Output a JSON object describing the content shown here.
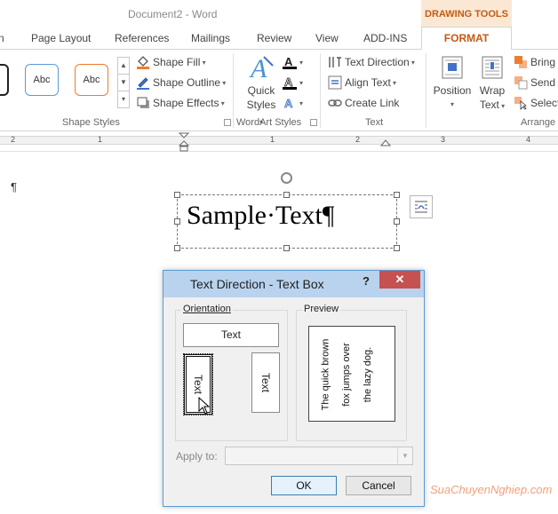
{
  "window": {
    "title": "Document2 - Word"
  },
  "contextual_tab_group": "DRAWING TOOLS",
  "tabs": [
    "n",
    "Page Layout",
    "References",
    "Mailings",
    "Review",
    "View",
    "ADD-INS"
  ],
  "active_tab": "FORMAT",
  "ribbon": {
    "shape_styles": {
      "gallery": [
        "Abc",
        "Abc"
      ],
      "shape_fill": "Shape Fill",
      "shape_outline": "Shape Outline",
      "shape_effects": "Shape Effects",
      "label": "Shape Styles"
    },
    "wordart_styles": {
      "quick_styles_line1": "Quick",
      "quick_styles_line2": "Styles",
      "label": "WordArt Styles"
    },
    "text": {
      "text_direction": "Text Direction",
      "align_text": "Align Text",
      "create_link": "Create Link",
      "label": "Text"
    },
    "arrange": {
      "position": "Position",
      "wrap_text_line1": "Wrap",
      "wrap_text_line2": "Text",
      "bring_forward": "Bring",
      "send_backward": "Send",
      "selection_pane": "Select",
      "label": "Arrange"
    }
  },
  "ruler": {
    "numbers": [
      "2",
      "1",
      "1",
      "2",
      "3",
      "4"
    ]
  },
  "document": {
    "paragraph_mark": "¶",
    "textbox_text": "Sample·Text¶"
  },
  "dialog": {
    "title": "Text Direction - Text Box",
    "help": "?",
    "close": "✕",
    "orientation_label": "Orientation",
    "orientation_horizontal": "Text",
    "orientation_vertical_down": "Text",
    "orientation_vertical_up": "Text",
    "selected_orientation": "vertical-rotated-90",
    "preview_label": "Preview",
    "preview_lines": [
      "The quick brown",
      "fox jumps over",
      "the lazy dog."
    ],
    "apply_to_label": "Apply to:",
    "apply_to_value": "",
    "ok": "OK",
    "cancel": "Cancel"
  },
  "watermark": "SuaChuyenNghiep.com",
  "colors": {
    "accent_orange": "#c55a11",
    "dialog_title_bg": "#b9d3ee",
    "close_red": "#c75050"
  }
}
